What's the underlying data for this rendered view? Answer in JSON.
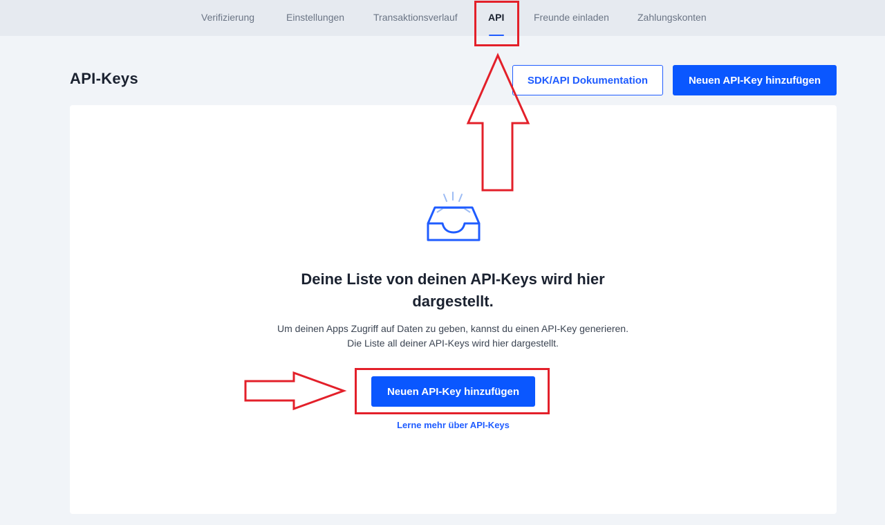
{
  "tabs": [
    {
      "label": "Verifizierung",
      "active": false
    },
    {
      "label": "Einstellungen",
      "active": false
    },
    {
      "label": "Transaktionsverlauf",
      "active": false
    },
    {
      "label": "API",
      "active": true
    },
    {
      "label": "Freunde einladen",
      "active": false
    },
    {
      "label": "Zahlungskonten",
      "active": false
    }
  ],
  "header": {
    "title": "API-Keys",
    "docs_button": "SDK/API Dokumentation",
    "add_button": "Neuen API-Key hinzufügen"
  },
  "empty_state": {
    "icon": "inbox-tray-icon",
    "heading": "Deine Liste von deinen API-Keys wird hier dargestellt.",
    "description": "Um deinen Apps Zugriff auf Daten zu geben, kannst du einen API-Key generieren. Die Liste all deiner API-Keys wird hier dargestellt.",
    "add_button": "Neuen API-Key hinzufügen",
    "learn_more": "Lerne mehr über API-Keys"
  },
  "colors": {
    "accent": "#0a57ff",
    "annotation": "#e3202a",
    "background": "#f1f4f8",
    "tabbar": "#e6eaf0"
  }
}
